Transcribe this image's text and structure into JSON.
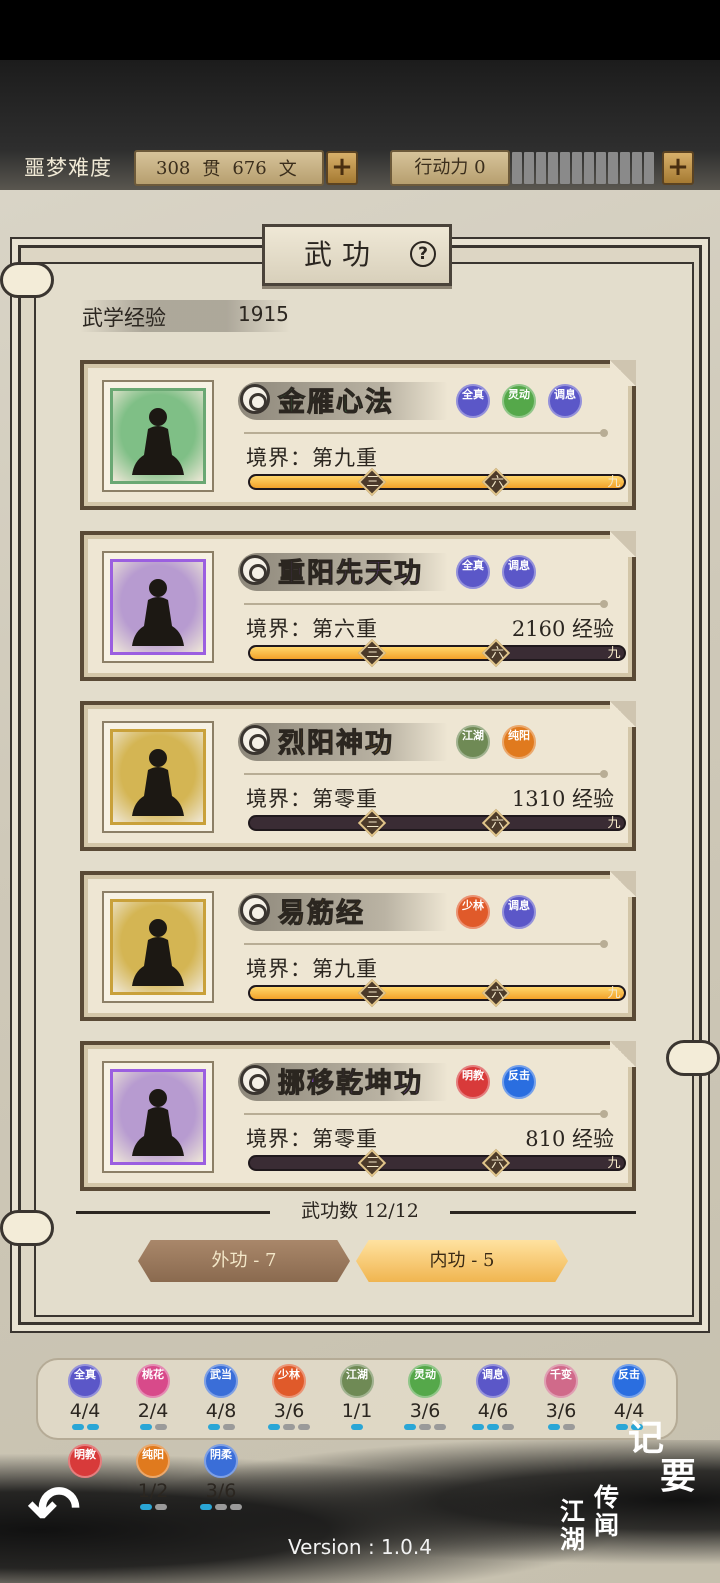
{
  "header": {
    "difficulty_label": "噩梦难度",
    "money_guan": "308",
    "money_guan_unit": "贯",
    "money_wen": "676",
    "money_wen_unit": "文",
    "action_label": "行动力 0",
    "plus": "+"
  },
  "panel": {
    "title": "武功",
    "help": "?",
    "exp_label": "武学经验",
    "exp_value": "1915"
  },
  "skills": [
    {
      "name": "金雁心法",
      "name_color": "#3f8f52",
      "frame_color": "#6aa873",
      "bg": "#7fbf86",
      "realm": "境界：第九重",
      "exp_need": "",
      "progress": 1.0,
      "tags": [
        {
          "text": "全真",
          "color": "#5b57c8"
        },
        {
          "text": "灵动",
          "color": "#55a84a"
        },
        {
          "text": "调息",
          "color": "#5b57c8"
        }
      ]
    },
    {
      "name": "重阳先天功",
      "name_color": "#8a4fd0",
      "frame_color": "#9b5fe0",
      "bg": "#b79bd0",
      "realm": "境界：第六重",
      "exp_need": "2160 经验",
      "progress": 0.66,
      "tags": [
        {
          "text": "全真",
          "color": "#5b57c8"
        },
        {
          "text": "调息",
          "color": "#5b57c8"
        }
      ]
    },
    {
      "name": "烈阳神功",
      "name_color": "#c08a1a",
      "frame_color": "#c9a13a",
      "bg": "#d4b553",
      "realm": "境界：第零重",
      "exp_need": "1310 经验",
      "progress": 0.0,
      "tags": [
        {
          "text": "江湖",
          "color": "#6f8a55"
        },
        {
          "text": "纯阳",
          "color": "#e07a1e"
        }
      ]
    },
    {
      "name": "易筋经",
      "name_color": "#c08a1a",
      "frame_color": "#c9a13a",
      "bg": "#d4b553",
      "realm": "境界：第九重",
      "exp_need": "",
      "progress": 1.0,
      "tags": [
        {
          "text": "少林",
          "color": "#e05a2a"
        },
        {
          "text": "调息",
          "color": "#5b57c8"
        }
      ]
    },
    {
      "name": "挪移乾坤功",
      "name_color": "#8a4fd0",
      "frame_color": "#9b5fe0",
      "bg": "#b79bd0",
      "realm": "境界：第零重",
      "exp_need": "810 经验",
      "progress": 0.0,
      "tags": [
        {
          "text": "明教",
          "color": "#d83a3a"
        },
        {
          "text": "反击",
          "color": "#2a6ee0"
        }
      ]
    }
  ],
  "bar_marks": [
    "三",
    "六",
    "九"
  ],
  "footer": {
    "skill_count": "武功数 12/12",
    "tab_outer": "外功 - 7",
    "tab_inner": "内功 - 5"
  },
  "schools": [
    {
      "text": "全真",
      "color": "#5b57c8",
      "count": "4/4",
      "pips": [
        1,
        1
      ]
    },
    {
      "text": "桃花",
      "color": "#d84a8a",
      "count": "2/4",
      "pips": [
        1,
        0
      ]
    },
    {
      "text": "武当",
      "color": "#3a6ed8",
      "count": "4/8",
      "pips": [
        1,
        0
      ]
    },
    {
      "text": "少林",
      "color": "#e05a2a",
      "count": "3/6",
      "pips": [
        1,
        0,
        0
      ]
    },
    {
      "text": "江湖",
      "color": "#6f8a55",
      "count": "1/1",
      "pips": [
        1
      ]
    },
    {
      "text": "灵动",
      "color": "#55a84a",
      "count": "3/6",
      "pips": [
        1,
        0,
        0
      ]
    },
    {
      "text": "调息",
      "color": "#5b57c8",
      "count": "4/6",
      "pips": [
        1,
        1,
        0
      ]
    },
    {
      "text": "千变",
      "color": "#d06a8a",
      "count": "3/6",
      "pips": [
        1,
        0
      ]
    },
    {
      "text": "反击",
      "color": "#2a6ee0",
      "count": "4/4",
      "pips": [
        1,
        1
      ]
    },
    {
      "text": "明教",
      "color": "#d83a3a",
      "count": "",
      "pips": []
    },
    {
      "text": "纯阳",
      "color": "#e07a1e",
      "count": "1/2",
      "pips": [
        1,
        0
      ]
    },
    {
      "text": "阴柔",
      "color": "#3a6ed8",
      "count": "3/6",
      "pips": [
        1,
        0,
        0
      ]
    }
  ],
  "nav": {
    "back": "↶",
    "jiyao_1": "记",
    "jiyao_2": "要",
    "jianghu_1": "传闻",
    "jianghu_2": "江湖",
    "version": "Version : 1.0.4"
  }
}
